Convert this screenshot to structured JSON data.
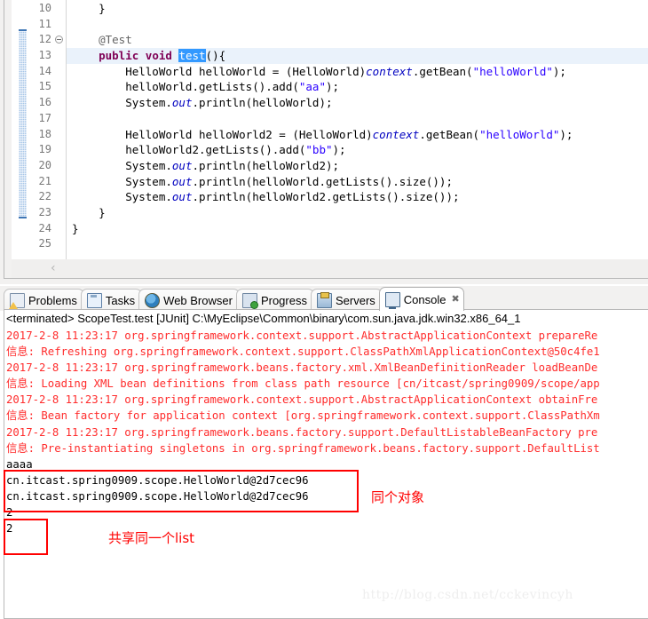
{
  "editor": {
    "first_line_number": 10,
    "highlighted_line": 13,
    "selected_token": "test",
    "fold_marker_line": 12,
    "method_range": {
      "from_line": 12,
      "to_line": 23
    },
    "scroll_arrow": "‹",
    "lines": [
      {
        "num": 10,
        "segments": [
          {
            "t": "    }",
            "c": "pl"
          }
        ]
      },
      {
        "num": 11,
        "segments": [
          {
            "t": "",
            "c": "pl"
          }
        ]
      },
      {
        "num": 12,
        "fold": true,
        "segments": [
          {
            "t": "    ",
            "c": "pl"
          },
          {
            "t": "@Test",
            "c": "ann"
          }
        ]
      },
      {
        "num": 13,
        "highlight": true,
        "segments": [
          {
            "t": "    ",
            "c": "pl"
          },
          {
            "t": "public",
            "c": "kw"
          },
          {
            "t": " ",
            "c": "pl"
          },
          {
            "t": "void",
            "c": "kw"
          },
          {
            "t": " ",
            "c": "pl"
          },
          {
            "t": "test",
            "c": "sel"
          },
          {
            "t": "(){",
            "c": "pl"
          }
        ]
      },
      {
        "num": 14,
        "segments": [
          {
            "t": "        HelloWorld helloWorld = (HelloWorld)",
            "c": "pl"
          },
          {
            "t": "context",
            "c": "fld"
          },
          {
            "t": ".getBean(",
            "c": "pl"
          },
          {
            "t": "\"helloWorld\"",
            "c": "str"
          },
          {
            "t": ");",
            "c": "pl"
          }
        ]
      },
      {
        "num": 15,
        "segments": [
          {
            "t": "        helloWorld.getLists().add(",
            "c": "pl"
          },
          {
            "t": "\"aa\"",
            "c": "str"
          },
          {
            "t": ");",
            "c": "pl"
          }
        ]
      },
      {
        "num": 16,
        "segments": [
          {
            "t": "        System.",
            "c": "pl"
          },
          {
            "t": "out",
            "c": "fld"
          },
          {
            "t": ".println(helloWorld);",
            "c": "pl"
          }
        ]
      },
      {
        "num": 17,
        "segments": [
          {
            "t": "",
            "c": "pl"
          }
        ]
      },
      {
        "num": 18,
        "segments": [
          {
            "t": "        HelloWorld helloWorld2 = (HelloWorld)",
            "c": "pl"
          },
          {
            "t": "context",
            "c": "fld"
          },
          {
            "t": ".getBean(",
            "c": "pl"
          },
          {
            "t": "\"helloWorld\"",
            "c": "str"
          },
          {
            "t": ");",
            "c": "pl"
          }
        ]
      },
      {
        "num": 19,
        "segments": [
          {
            "t": "        helloWorld2.getLists().add(",
            "c": "pl"
          },
          {
            "t": "\"bb\"",
            "c": "str"
          },
          {
            "t": ");",
            "c": "pl"
          }
        ]
      },
      {
        "num": 20,
        "segments": [
          {
            "t": "        System.",
            "c": "pl"
          },
          {
            "t": "out",
            "c": "fld"
          },
          {
            "t": ".println(helloWorld2);",
            "c": "pl"
          }
        ]
      },
      {
        "num": 21,
        "segments": [
          {
            "t": "        System.",
            "c": "pl"
          },
          {
            "t": "out",
            "c": "fld"
          },
          {
            "t": ".println(helloWorld.getLists().size());",
            "c": "pl"
          }
        ]
      },
      {
        "num": 22,
        "segments": [
          {
            "t": "        System.",
            "c": "pl"
          },
          {
            "t": "out",
            "c": "fld"
          },
          {
            "t": ".println(helloWorld2.getLists().size());",
            "c": "pl"
          }
        ]
      },
      {
        "num": 23,
        "segments": [
          {
            "t": "    }",
            "c": "pl"
          }
        ]
      },
      {
        "num": 24,
        "segments": [
          {
            "t": "}",
            "c": "pl"
          }
        ]
      },
      {
        "num": 25,
        "segments": [
          {
            "t": "",
            "c": "pl"
          }
        ]
      }
    ]
  },
  "tabs": [
    {
      "label": "Problems",
      "icon": "problems-icon",
      "icon_class": "ico-problems",
      "active": false,
      "closable": false
    },
    {
      "label": "Tasks",
      "icon": "tasks-icon",
      "icon_class": "ico-tasks",
      "active": false,
      "closable": false
    },
    {
      "label": "Web Browser",
      "icon": "web-browser-icon",
      "icon_class": "ico-web",
      "active": false,
      "closable": false
    },
    {
      "label": "Progress",
      "icon": "progress-icon",
      "icon_class": "ico-progress",
      "active": false,
      "closable": false
    },
    {
      "label": "Servers",
      "icon": "servers-icon",
      "icon_class": "ico-servers",
      "active": false,
      "closable": false
    },
    {
      "label": "Console",
      "icon": "console-icon",
      "icon_class": "ico-console",
      "active": true,
      "closable": true,
      "close_glyph": "✖"
    }
  ],
  "console": {
    "header": "<terminated> ScopeTest.test [JUnit] C:\\MyEclipse\\Common\\binary\\com.sun.java.jdk.win32.x86_64_1",
    "lines": [
      {
        "text": "2017-2-8 11:23:17 org.springframework.context.support.AbstractApplicationContext prepareRe",
        "style": "log-red"
      },
      {
        "text": "信息: Refreshing org.springframework.context.support.ClassPathXmlApplicationContext@50c4fe1",
        "style": "log-red"
      },
      {
        "text": "2017-2-8 11:23:17 org.springframework.beans.factory.xml.XmlBeanDefinitionReader loadBeanDe",
        "style": "log-red"
      },
      {
        "text": "信息: Loading XML bean definitions from class path resource [cn/itcast/spring0909/scope/app",
        "style": "log-red"
      },
      {
        "text": "2017-2-8 11:23:17 org.springframework.context.support.AbstractApplicationContext obtainFre",
        "style": "log-red"
      },
      {
        "text": "信息: Bean factory for application context [org.springframework.context.support.ClassPathXm",
        "style": "log-red"
      },
      {
        "text": "2017-2-8 11:23:17 org.springframework.beans.factory.support.DefaultListableBeanFactory pre",
        "style": "log-red"
      },
      {
        "text": "信息: Pre-instantiating singletons in org.springframework.beans.factory.support.DefaultList",
        "style": "log-red"
      },
      {
        "text": "aaaa",
        "style": "out-black"
      },
      {
        "text": "cn.itcast.spring0909.scope.HelloWorld@2d7cec96",
        "style": "out-black"
      },
      {
        "text": "cn.itcast.spring0909.scope.HelloWorld@2d7cec96",
        "style": "out-black"
      },
      {
        "text": "2",
        "style": "out-black"
      },
      {
        "text": "2",
        "style": "out-black"
      }
    ]
  },
  "annotations": {
    "same_object": "同个对象",
    "same_list": "共享同一个list",
    "box_color": "#ff0000"
  },
  "watermark": "http://blog.csdn.net/cckevincyh"
}
